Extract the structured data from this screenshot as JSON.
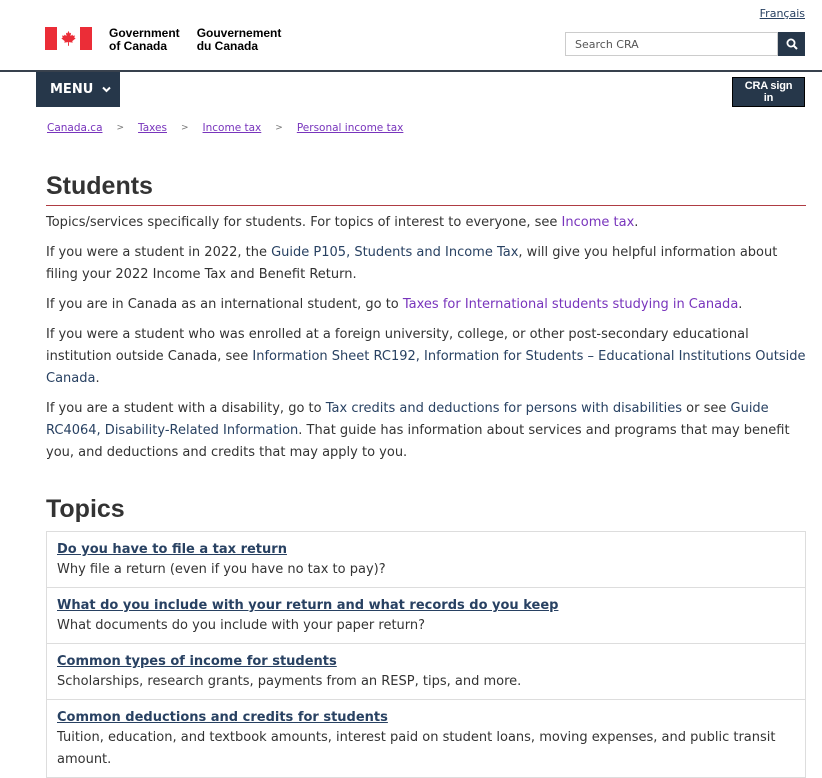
{
  "header": {
    "language_link": "Français",
    "signature_en_line1": "Government",
    "signature_en_line2": "of Canada",
    "signature_fr_line1": "Gouvernement",
    "signature_fr_line2": "du Canada",
    "search_placeholder": "Search CRA",
    "flag_colors": {
      "red": "#eb2d37",
      "white": "#ffffff"
    }
  },
  "nav": {
    "menu_label": "MENU",
    "signin_label": "CRA sign in"
  },
  "breadcrumb": [
    "Canada.ca",
    "Taxes",
    "Income tax",
    "Personal income tax"
  ],
  "page": {
    "title": "Students",
    "p1_pre": "Topics/services specifically for students. For topics of interest to everyone, see ",
    "p1_link": "Income tax",
    "p1_post": ".",
    "p2_pre": "If you were a student in 2022, the ",
    "p2_link": "Guide P105, Students and Income Tax",
    "p2_post": ", will give you helpful information about filing your 2022 Income Tax and Benefit Return.",
    "p3_pre": "If you are in Canada as an international student, go to ",
    "p3_link": "Taxes for International students studying in Canada",
    "p3_post": ".",
    "p4_pre": "If you were a student who was enrolled at a foreign university, college, or other post-secondary educational institution outside Canada, see ",
    "p4_link": "Information Sheet RC192, Information for Students – Educational Institutions Outside Canada",
    "p4_post": ".",
    "p5_pre": "If you are a student with a disability, go to ",
    "p5_link1": "Tax credits and deductions for persons with disabilities",
    "p5_mid": " or see ",
    "p5_link2": "Guide RC4064, Disability-Related Information",
    "p5_post": ". That guide has information about services and programs that may benefit you, and deductions and credits that may apply to you."
  },
  "topics": {
    "heading": "Topics",
    "items": [
      {
        "title": "Do you have to file a tax return",
        "desc": "Why file a return (even if you have no tax to pay)?"
      },
      {
        "title": "What do you include with your return and what records do you keep",
        "desc": "What documents do you include with your paper return?"
      },
      {
        "title": "Common types of income for students",
        "desc": "Scholarships, research grants, payments from an RESP, tips, and more."
      },
      {
        "title": "Common deductions and credits for students",
        "desc": "Tuition, education, and textbook amounts, interest paid on student loans, moving expenses, and public transit amount."
      }
    ]
  }
}
